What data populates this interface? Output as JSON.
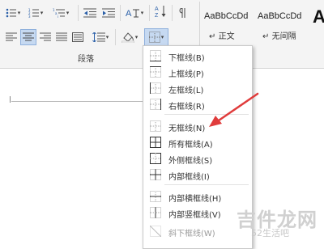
{
  "ribbon": {
    "group_label": "段落",
    "icons": {
      "row1": [
        "bullets-icon",
        "numbering-icon",
        "multilevel-list-icon",
        "decrease-indent-icon",
        "increase-indent-icon",
        "chinese-layout-icon",
        "sort-icon",
        "show-marks-icon"
      ],
      "row2": [
        "align-left-icon",
        "align-center-icon",
        "align-right-icon",
        "justify-icon",
        "distributed-icon",
        "line-spacing-icon",
        "shading-icon",
        "borders-icon"
      ]
    }
  },
  "styles": {
    "items": [
      {
        "sample": "AaBbCcDd",
        "name": "正文",
        "prefix": "↵"
      },
      {
        "sample": "AaBbCcDd",
        "name": "无间隔",
        "prefix": "↵"
      }
    ],
    "heading_sample": "A"
  },
  "border_menu": {
    "items": [
      {
        "label": "下框线(B)",
        "icon": "bottom-border-icon"
      },
      {
        "label": "上框线(P)",
        "icon": "top-border-icon"
      },
      {
        "label": "左框线(L)",
        "icon": "left-border-icon"
      },
      {
        "label": "右框线(R)",
        "icon": "right-border-icon"
      },
      {
        "label": "无框线(N)",
        "icon": "no-border-icon"
      },
      {
        "label": "所有框线(A)",
        "icon": "all-borders-icon"
      },
      {
        "label": "外侧框线(S)",
        "icon": "outside-borders-icon"
      },
      {
        "label": "内部框线(I)",
        "icon": "inside-borders-icon"
      },
      {
        "label": "内部横框线(H)",
        "icon": "inside-horizontal-border-icon"
      },
      {
        "label": "内部竖框线(V)",
        "icon": "inside-vertical-border-icon"
      },
      {
        "label": "斜下框线(W)",
        "icon": "diagonal-down-border-icon",
        "disabled": true
      }
    ]
  },
  "annotation": {
    "color": "#e03c3c",
    "points_to": "无框线(N)"
  },
  "watermark": {
    "main": "吉件龙网",
    "sub": "52生活吧"
  }
}
